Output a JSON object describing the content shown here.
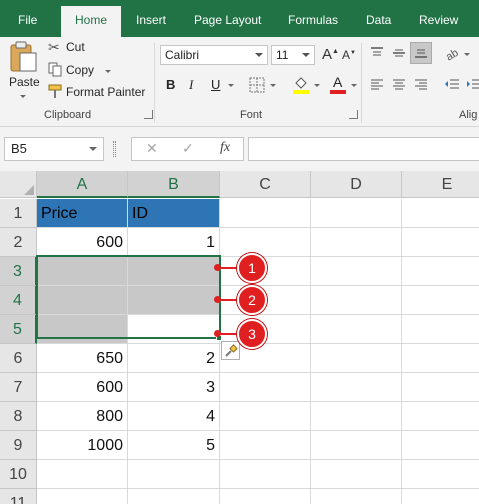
{
  "tabs": [
    "File",
    "Home",
    "Insert",
    "Page Layout",
    "Formulas",
    "Data",
    "Review"
  ],
  "active_tab": "Home",
  "clipboard": {
    "paste_label": "Paste",
    "cut_label": "Cut",
    "copy_label": "Copy",
    "format_painter_label": "Format Painter",
    "group_label": "Clipboard"
  },
  "font": {
    "name": "Calibri",
    "size": "11",
    "bold": "B",
    "italic": "I",
    "underline": "U",
    "font_color_glyph": "A",
    "group_label": "Font"
  },
  "alignment": {
    "group_label_partial": "Alig"
  },
  "formula_bar": {
    "name_box": "B5",
    "cancel_glyph": "✕",
    "enter_glyph": "✓",
    "fx_glyph": "fx",
    "formula_value": ""
  },
  "columns": [
    "A",
    "B",
    "C",
    "D",
    "E"
  ],
  "rows": [
    "1",
    "2",
    "3",
    "4",
    "5",
    "6",
    "7",
    "8",
    "9",
    "10",
    "11"
  ],
  "cells": {
    "A1": "Price",
    "B1": "ID",
    "A2": "600",
    "B2": "1",
    "A6": "650",
    "B6": "2",
    "A7": "600",
    "B7": "3",
    "A8": "800",
    "B8": "4",
    "A9": "1000",
    "B9": "5"
  },
  "callouts": [
    "1",
    "2",
    "3"
  ],
  "colors": {
    "accent": "#217346",
    "header_fill": "#2e75b6",
    "callout": "#e02020",
    "selected_fill": "#c8c8c8"
  }
}
